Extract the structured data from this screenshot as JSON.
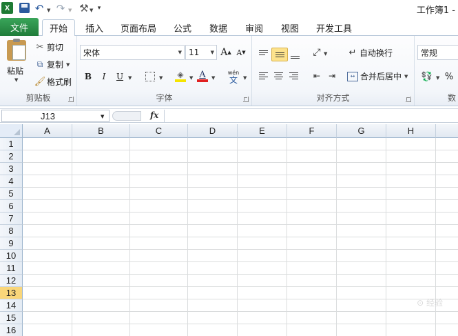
{
  "title_bar": {
    "app_icon": "X",
    "title": "工作簿1 -"
  },
  "tabs": [
    {
      "label": "文件"
    },
    {
      "label": "开始"
    },
    {
      "label": "插入"
    },
    {
      "label": "页面布局"
    },
    {
      "label": "公式"
    },
    {
      "label": "数据"
    },
    {
      "label": "审阅"
    },
    {
      "label": "视图"
    },
    {
      "label": "开发工具"
    }
  ],
  "ribbon": {
    "clipboard": {
      "paste": "粘贴",
      "cut": "剪切",
      "copy": "复制",
      "format_painter": "格式刷",
      "label": "剪贴板"
    },
    "font": {
      "name": "宋体",
      "size": "11",
      "grow": "A",
      "shrink": "A",
      "bold": "B",
      "italic": "I",
      "underline": "U",
      "phonetic": "wén",
      "phonetic_sub": "文",
      "label": "字体",
      "fill_color": "#f5e400",
      "font_color": "#e02020"
    },
    "alignment": {
      "wrap_text": "自动换行",
      "merge_center": "合并后居中",
      "label": "对齐方式"
    },
    "number": {
      "format": "常规",
      "percent": "%",
      "label": "数"
    }
  },
  "formula_bar": {
    "name_box": "J13",
    "fx": "fx",
    "formula": ""
  },
  "grid": {
    "columns": [
      "A",
      "B",
      "C",
      "D",
      "E",
      "F",
      "G",
      "H"
    ],
    "rows": [
      "1",
      "2",
      "3",
      "4",
      "5",
      "6",
      "7",
      "8",
      "9",
      "10",
      "11",
      "12",
      "13",
      "14",
      "15",
      "16"
    ],
    "active_row": "13",
    "active_color": "#f9d67a"
  }
}
